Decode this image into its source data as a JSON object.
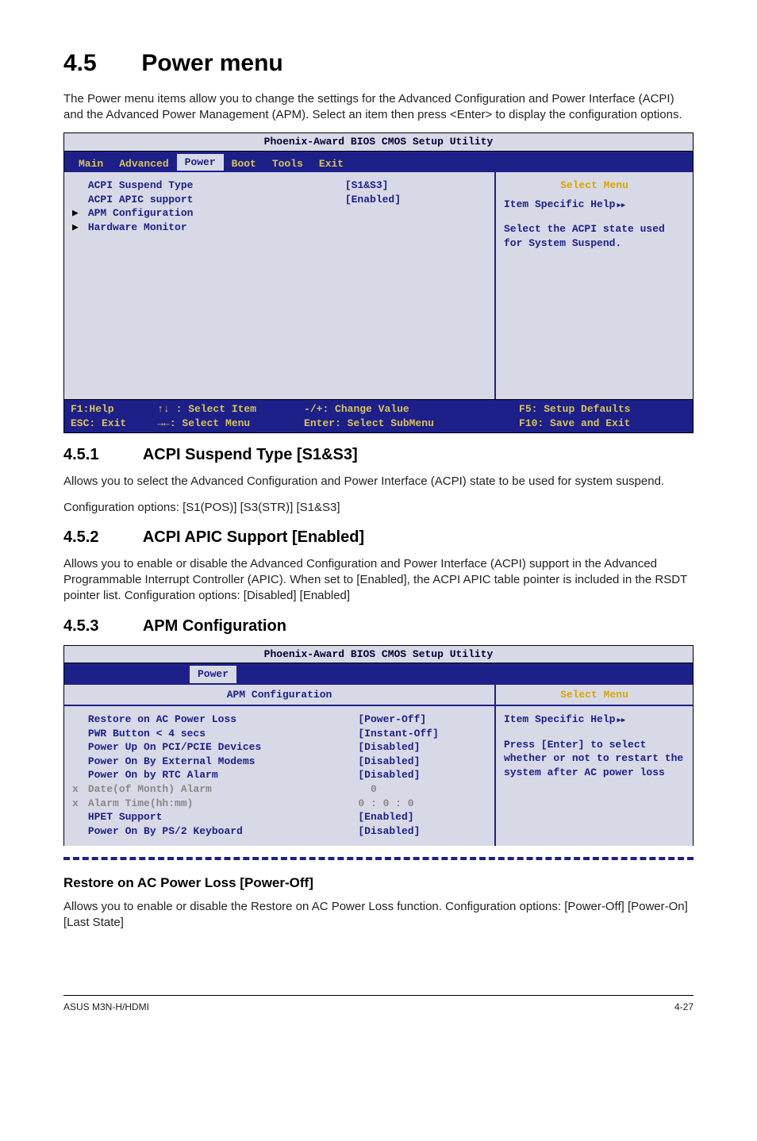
{
  "section": {
    "num": "4.5",
    "title": "Power menu"
  },
  "intro": "The Power menu items allow you to change the settings for the Advanced Configuration and Power Interface (ACPI) and the Advanced Power Management (APM). Select an item then press <Enter> to display the configuration options.",
  "bios1": {
    "titlebar": "Phoenix-Award BIOS CMOS Setup Utility",
    "menu": [
      "Main",
      "Advanced",
      "Power",
      "Boot",
      "Tools",
      "Exit"
    ],
    "selected_menu_index": 2,
    "rows": [
      {
        "arrow": " ",
        "label": "ACPI Suspend Type",
        "value": "[S1&S3]"
      },
      {
        "arrow": " ",
        "label": "ACPI APIC support",
        "value": "[Enabled]"
      },
      {
        "arrow": "▶",
        "label": "APM Configuration",
        "value": ""
      },
      {
        "arrow": "▶",
        "label": "Hardware Monitor",
        "value": ""
      }
    ],
    "right": {
      "heading": "Select Menu",
      "help_label": "Item Specific Help",
      "help_body": "Select the ACPI state used for System Suspend."
    },
    "footer": {
      "col1": "F1:Help       ↑↓ : Select Item\nESC: Exit     →←: Select Menu",
      "col2": "-/+: Change Value\nEnter: Select SubMenu",
      "col3": "F5: Setup Defaults\nF10: Save and Exit"
    }
  },
  "s451": {
    "num": "4.5.1",
    "title": "ACPI Suspend Type [S1&S3]",
    "body1": "Allows you to select the Advanced Configuration and Power Interface (ACPI) state to be used for system suspend.",
    "body2": "Configuration options: [S1(POS)] [S3(STR)] [S1&S3]"
  },
  "s452": {
    "num": "4.5.2",
    "title": "ACPI APIC Support [Enabled]",
    "body": "Allows you to enable or disable the Advanced Configuration and Power Interface (ACPI) support in the Advanced Programmable Interrupt Controller (APIC). When set to [Enabled], the ACPI APIC table pointer is included in the RSDT pointer list. Configuration options: [Disabled] [Enabled]"
  },
  "s453": {
    "num": "4.5.3",
    "title": "APM Configuration"
  },
  "bios2": {
    "titlebar": "Phoenix-Award BIOS CMOS Setup Utility",
    "menu_selected": "Power",
    "config_header": "APM Configuration",
    "right_heading": "Select Menu",
    "rows": [
      {
        "arrow": " ",
        "label": "Restore on AC Power Loss",
        "value": "[Power-Off]",
        "grey": false
      },
      {
        "arrow": " ",
        "label": "PWR Button < 4 secs",
        "value": "[Instant-Off]",
        "grey": false
      },
      {
        "arrow": " ",
        "label": "Power Up On PCI/PCIE Devices",
        "value": "[Disabled]",
        "grey": false
      },
      {
        "arrow": " ",
        "label": "Power On By External Modems",
        "value": "[Disabled]",
        "grey": false
      },
      {
        "arrow": " ",
        "label": "Power On by RTC Alarm",
        "value": "[Disabled]",
        "grey": false
      },
      {
        "arrow": "x",
        "label": "Date(of Month) Alarm",
        "value": "  0",
        "grey": true
      },
      {
        "arrow": "x",
        "label": "Alarm Time(hh:mm)",
        "value": "0 : 0 : 0",
        "grey": true
      },
      {
        "arrow": " ",
        "label": "HPET Support",
        "value": "[Enabled]",
        "grey": false
      },
      {
        "arrow": " ",
        "label": "Power On By PS/2 Keyboard",
        "value": "[Disabled]",
        "grey": false
      }
    ],
    "right": {
      "help_label": "Item Specific Help",
      "help_body": "Press [Enter] to select whether or not to restart the system after AC power loss"
    }
  },
  "restore": {
    "title": "Restore on AC Power Loss [Power-Off]",
    "body": "Allows you to enable or disable the Restore on AC Power Loss function. Configuration options: [Power-Off] [Power-On] [Last State]"
  },
  "footer": {
    "left": "ASUS M3N-H/HDMI",
    "right": "4-27"
  }
}
